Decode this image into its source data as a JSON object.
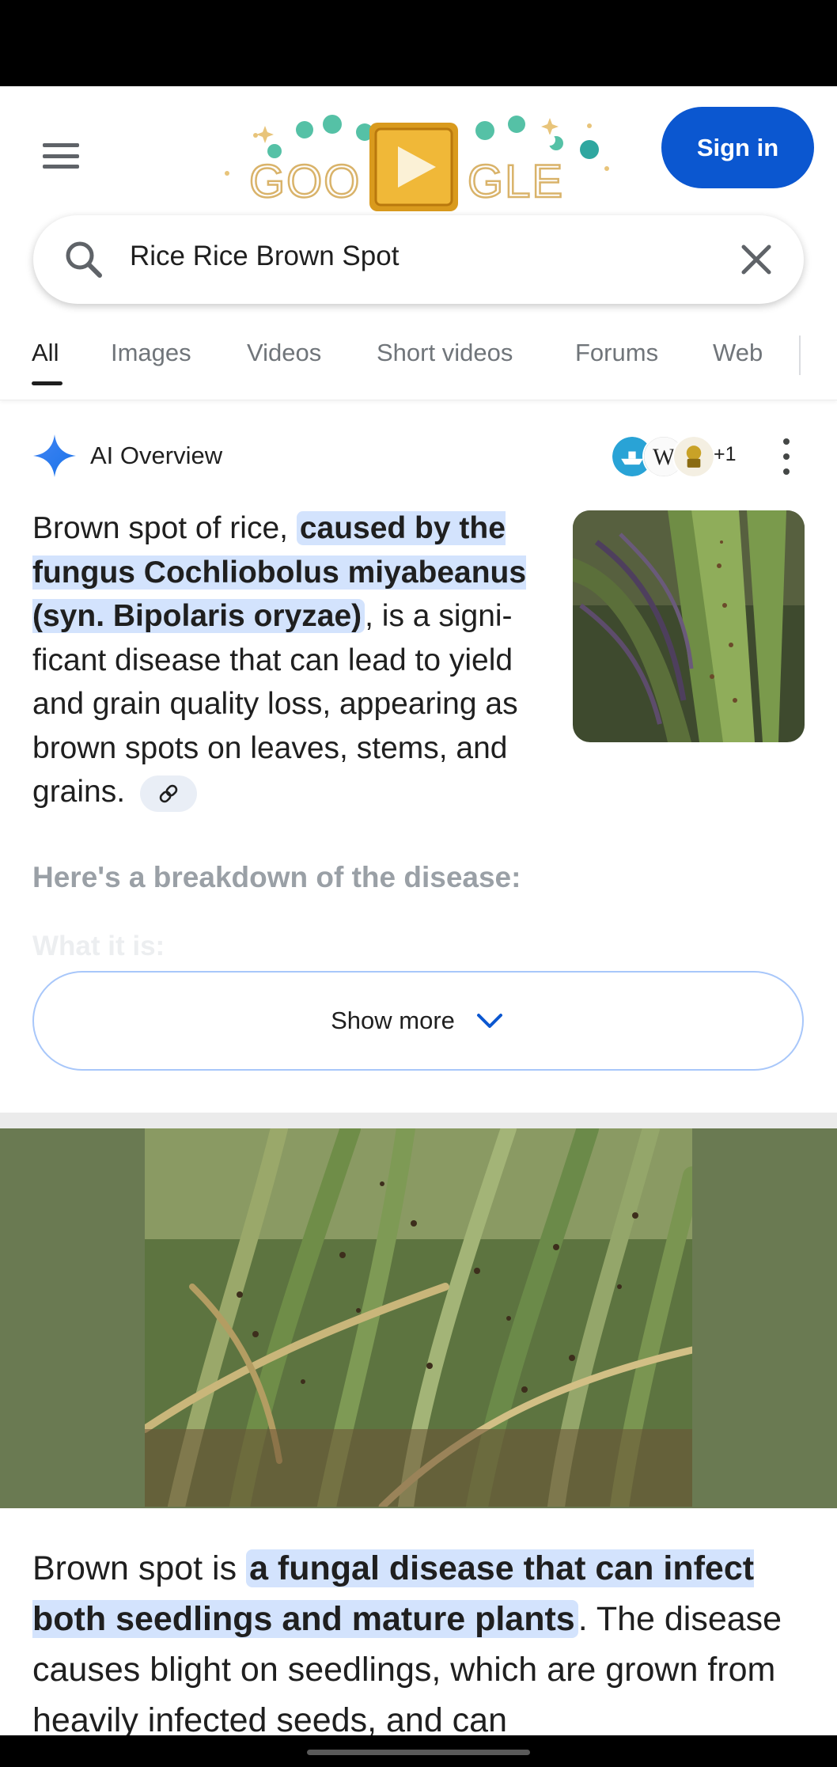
{
  "header": {
    "logo_alt": "GOOGLE",
    "signin_label": "Sign in"
  },
  "search": {
    "query": "Rice Rice Brown Spot"
  },
  "tabs": [
    {
      "label": "All",
      "active": true
    },
    {
      "label": "Images"
    },
    {
      "label": "Videos"
    },
    {
      "label": "Short videos"
    },
    {
      "label": "Forums"
    },
    {
      "label": "Web"
    }
  ],
  "ai_overview": {
    "title": "AI Overview",
    "source_icons": [
      "boat-source-icon",
      "wikipedia-icon",
      "emblem-source-icon"
    ],
    "source_extra_count": "+1",
    "text_before": "Brown spot of rice, ",
    "text_highlight": "caused by the fungus Cochliobolus miyabeanus (syn. Bipolaris oryzae)",
    "text_after": ", is a signi­ficant disease that can lead to yield and grain quality loss, appearing as brown spots on leaves, stems, and grains.",
    "breakdown_heading": "Here's a breakdown of the disease:",
    "faded_subheading": "What it is:",
    "show_more_label": "Show more"
  },
  "article": {
    "text_before": "Brown spot is ",
    "text_highlight": "a fungal disease that can infect both seedlings and mature plants",
    "text_after": ". The disease causes blight on seedlings, which are grown from heavily infected seeds, and can"
  },
  "colors": {
    "accent": "#0b57d0",
    "highlight": "#d3e3fd",
    "chip": "#e9eef6",
    "image_band": "#6a7a52"
  }
}
